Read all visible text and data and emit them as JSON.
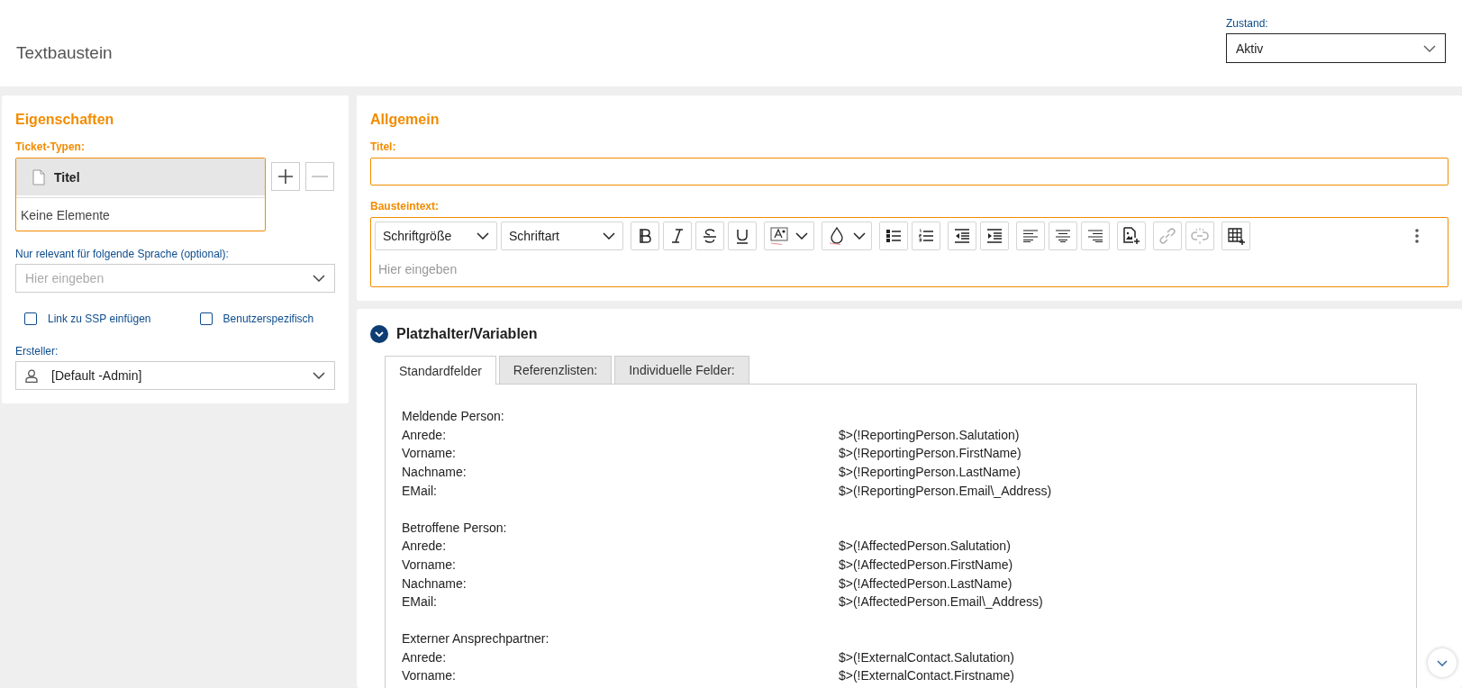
{
  "header": {
    "title": "Textbaustein",
    "status": {
      "label": "Zustand:",
      "value": "Aktiv"
    }
  },
  "properties": {
    "title": "Eigenschaften",
    "ticket_types": {
      "label": "Ticket-Typen:",
      "column": "Titel",
      "empty_text": "Keine Elemente",
      "add_disabled": false,
      "remove_disabled": true
    },
    "language": {
      "label": "Nur relevant für folgende Sprache (optional):",
      "placeholder": "Hier eingeben"
    },
    "checkboxes": [
      {
        "label": "Link zu SSP einfügen",
        "checked": false
      },
      {
        "label": "Benutzerspezifisch",
        "checked": false
      }
    ],
    "creator": {
      "label": "Ersteller:",
      "value": "[Default -Admin]"
    }
  },
  "general": {
    "title": "Allgemein",
    "title_field": {
      "label": "Titel:"
    },
    "text_field": {
      "label": "Bausteintext:",
      "placeholder": "Hier eingeben"
    },
    "toolbar": [
      {
        "kind": "select",
        "label": "Schriftgröße",
        "disabled": false
      },
      {
        "kind": "select",
        "label": "Schriftart",
        "disabled": false
      },
      {
        "kind": "bold",
        "disabled": false
      },
      {
        "kind": "italic",
        "disabled": false
      },
      {
        "kind": "strike",
        "disabled": false
      },
      {
        "kind": "underline",
        "disabled": false
      },
      {
        "kind": "fontcolor",
        "disabled": false
      },
      {
        "kind": "bgcolor",
        "disabled": false
      },
      {
        "kind": "bullets",
        "disabled": false
      },
      {
        "kind": "numbers",
        "disabled": false
      },
      {
        "kind": "outdent",
        "disabled": false
      },
      {
        "kind": "indent",
        "disabled": false
      },
      {
        "kind": "alignleft",
        "disabled": false
      },
      {
        "kind": "aligncenter",
        "disabled": false
      },
      {
        "kind": "alignright",
        "disabled": false
      },
      {
        "kind": "image",
        "disabled": false
      },
      {
        "kind": "link",
        "disabled": true
      },
      {
        "kind": "unlink",
        "disabled": true
      },
      {
        "kind": "table",
        "disabled": false
      },
      {
        "kind": "more",
        "disabled": false
      }
    ]
  },
  "placeholders": {
    "title": "Platzhalter/Variablen",
    "expanded": true,
    "tabs": [
      {
        "label": "Standardfelder",
        "selected": true
      },
      {
        "label": "Referenzlisten:",
        "selected": false
      },
      {
        "label": "Individuelle Felder:",
        "selected": false
      }
    ],
    "groups": [
      {
        "title": "Meldende Person:",
        "rows": [
          {
            "label": "Anrede:",
            "value": "$>(!ReportingPerson.Salutation)"
          },
          {
            "label": "Vorname:",
            "value": "$>(!ReportingPerson.FirstName)"
          },
          {
            "label": "Nachname:",
            "value": "$>(!ReportingPerson.LastName)"
          },
          {
            "label": "EMail:",
            "value": "$>(!ReportingPerson.Email\\_Address)"
          }
        ]
      },
      {
        "title": "Betroffene Person:",
        "rows": [
          {
            "label": "Anrede:",
            "value": "$>(!AffectedPerson.Salutation)"
          },
          {
            "label": "Vorname:",
            "value": "$>(!AffectedPerson.FirstName)"
          },
          {
            "label": "Nachname:",
            "value": "$>(!AffectedPerson.LastName)"
          },
          {
            "label": "EMail:",
            "value": "$>(!AffectedPerson.Email\\_Address)"
          }
        ]
      },
      {
        "title": "Externer Ansprechpartner:",
        "rows": [
          {
            "label": "Anrede:",
            "value": "$>(!ExternalContact.Salutation)"
          },
          {
            "label": "Vorname:",
            "value": "$>(!ExternalContact.Firstname)"
          }
        ]
      }
    ]
  }
}
